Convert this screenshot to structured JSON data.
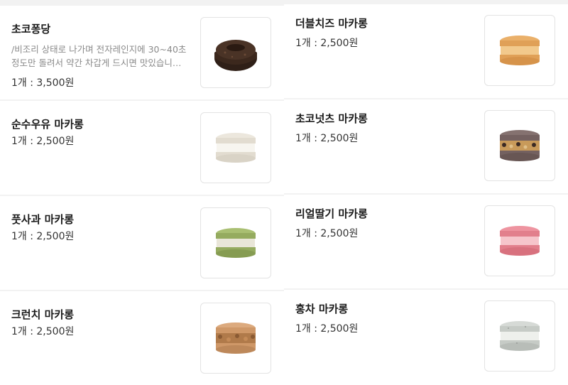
{
  "left_column": [
    {
      "name": "초코퐁당",
      "description": "/비조리 상태로 나가며 전자레인지에 30~40초 정도만 돌려서 약간 차갑게 드시면 맛있습니…",
      "price": "1개 : 3,500원",
      "image": "choco-fondant-image",
      "colors": {
        "top": "#4a3326",
        "side": "#2f1f17"
      }
    },
    {
      "name": "순수우유 마카롱",
      "price": "1개 : 2,500원",
      "image": "milk-macaron-image",
      "colors": {
        "shell": "#ece7dd",
        "filling": "#f7f5ef"
      }
    },
    {
      "name": "풋사과 마카롱",
      "price": "1개 : 2,500원",
      "image": "green-apple-macaron-image",
      "colors": {
        "shell": "#9fb56a",
        "filling": "#e9e6d8"
      }
    },
    {
      "name": "크런치 마카롱",
      "price": "1개 : 2,500원",
      "image": "crunch-macaron-image",
      "colors": {
        "shell": "#d6a072",
        "filling": "#b07a4a"
      }
    }
  ],
  "right_column": [
    {
      "name": "더블치즈 마카롱",
      "price": "1개 : 2,500원",
      "image": "double-cheese-macaron-image",
      "colors": {
        "shell": "#e7a55a",
        "filling": "#f2c98c"
      }
    },
    {
      "name": "초코넛츠 마카롱",
      "price": "1개 : 2,500원",
      "image": "choco-nuts-macaron-image",
      "colors": {
        "shell": "#7a6663",
        "filling": "#c89a5a"
      }
    },
    {
      "name": "리얼딸기 마카롱",
      "price": "1개 : 2,500원",
      "image": "strawberry-macaron-image",
      "colors": {
        "shell": "#ea8a96",
        "filling": "#f6c5cb"
      }
    },
    {
      "name": "홍차 마카롱",
      "price": "1개 : 2,500원",
      "image": "black-tea-macaron-image",
      "colors": {
        "shell": "#cfd3cf",
        "filling": "#eef0ec"
      }
    }
  ]
}
